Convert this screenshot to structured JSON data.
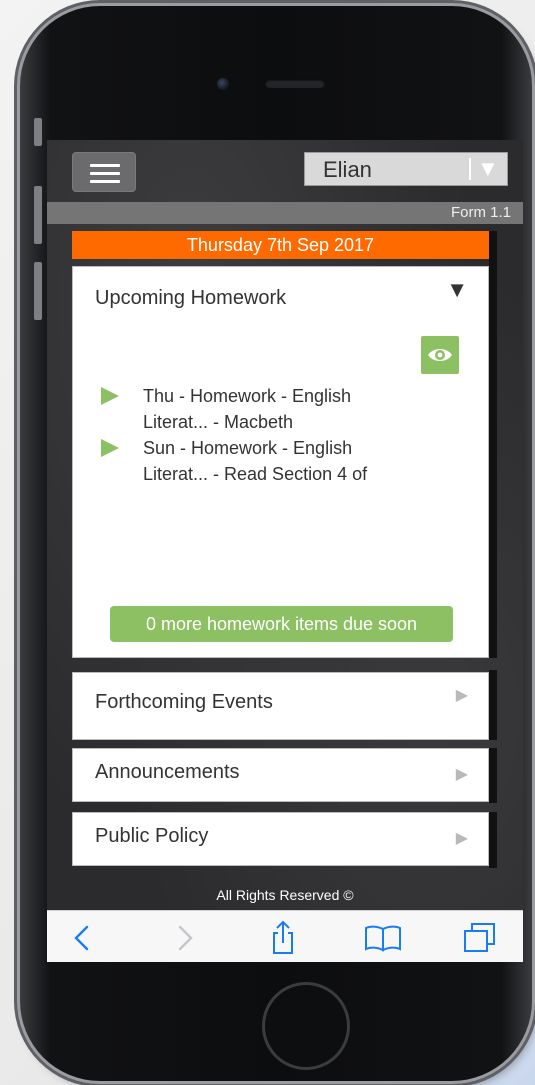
{
  "header": {
    "student_select": "Elian",
    "form_label": "Form 1.1"
  },
  "date_banner": "Thursday 7th Sep 2017",
  "homework_card": {
    "title": "Upcoming Homework",
    "items": [
      {
        "line1": "Thu - Homework - English",
        "line2": "Literat... - Macbeth"
      },
      {
        "line1": "Sun - Homework - English",
        "line2": "Literat... - Read Section 4 of"
      }
    ],
    "more_button": "0 more homework items due soon"
  },
  "sections": [
    {
      "title": "Forthcoming Events"
    },
    {
      "title": "Announcements"
    },
    {
      "title": "Public Policy"
    }
  ],
  "footer": "All Rights Reserved ©",
  "browser_toolbar": {
    "icons": [
      "back-icon",
      "forward-icon",
      "share-icon",
      "bookmarks-icon",
      "tabs-icon"
    ]
  },
  "colors": {
    "accent_orange": "#ff6a00",
    "accent_green": "#8cc063",
    "ios_blue": "#1a7cf5"
  }
}
